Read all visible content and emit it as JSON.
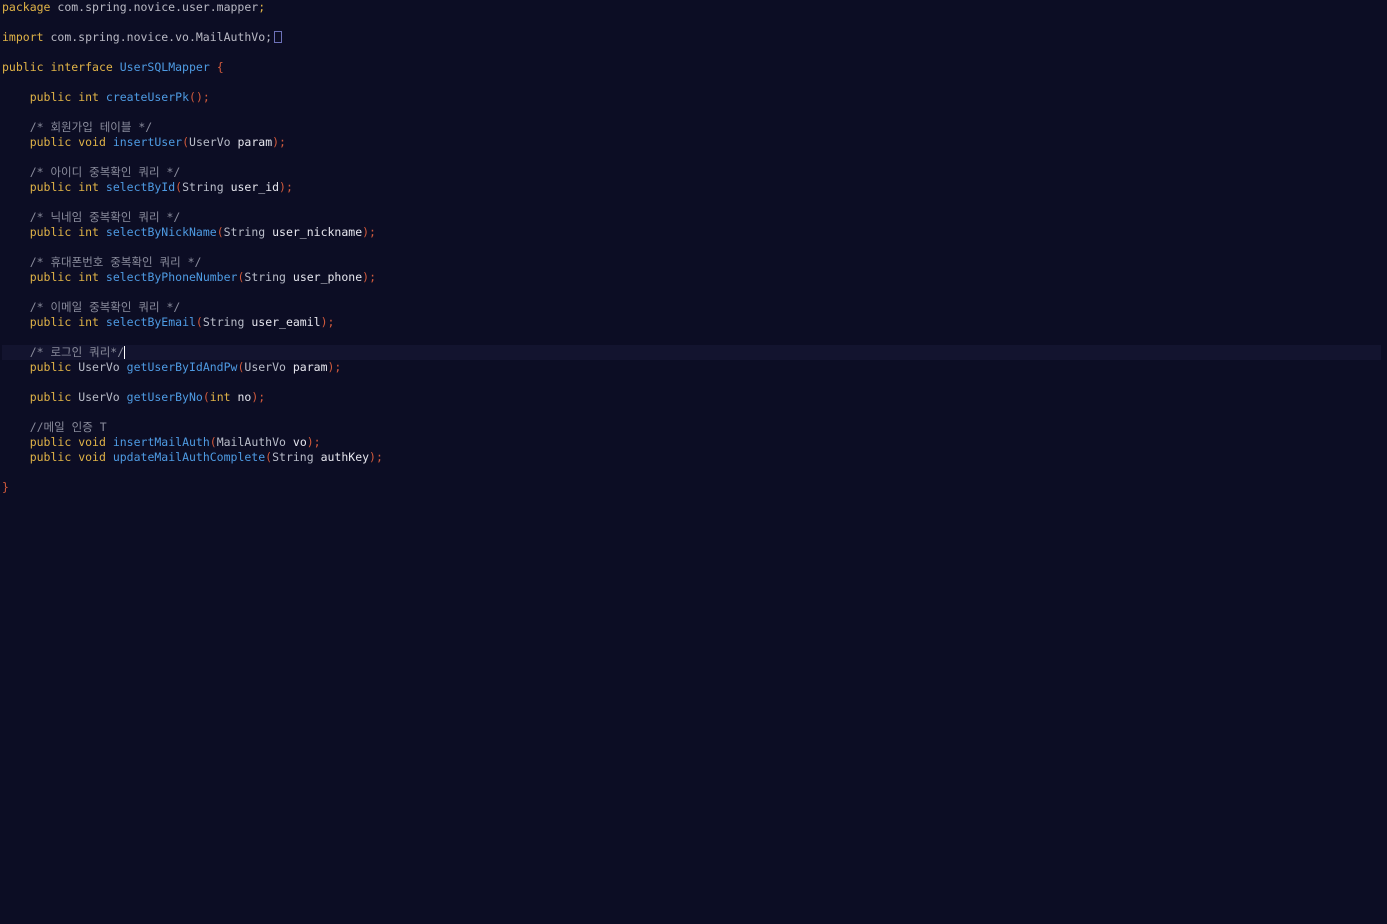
{
  "editor": {
    "package_line": {
      "keyword": "package",
      "name": "com.spring.novice.user.mapper",
      "semi": ";"
    },
    "import_line": {
      "keyword": "import",
      "name": "com.spring.novice.vo.MailAuthVo;"
    },
    "interface_decl": {
      "public": "public",
      "interface": "interface",
      "name": "UserSQLMapper",
      "open_brace": "{"
    },
    "methods": [
      {
        "comment": "",
        "public": "public",
        "ret": "int",
        "name": "createUserPk",
        "lparen": "(",
        "ptype": "",
        "pname": "",
        "rparen": ");"
      },
      {
        "comment": "/* 회원가입 테이블 */",
        "public": "public",
        "ret": "void",
        "name": "insertUser",
        "lparen": "(",
        "ptype": "UserVo",
        "pname": "param",
        "rparen": ");"
      },
      {
        "comment": "/* 아이디 중복확인 쿼리 */",
        "public": "public",
        "ret": "int",
        "name": "selectById",
        "lparen": "(",
        "ptype": "String",
        "pname": "user_id",
        "rparen": ");"
      },
      {
        "comment": "/* 닉네임 중복확인 쿼리 */",
        "public": "public",
        "ret": "int",
        "name": "selectByNickName",
        "lparen": "(",
        "ptype": "String",
        "pname": "user_nickname",
        "rparen": ");"
      },
      {
        "comment": "/* 휴대폰번호 중복확인 쿼리 */",
        "public": "public",
        "ret": "int",
        "name": "selectByPhoneNumber",
        "lparen": "(",
        "ptype": "String",
        "pname": "user_phone",
        "rparen": ");"
      },
      {
        "comment": "/* 이메일 중복확인 쿼리 */",
        "public": "public",
        "ret": "int",
        "name": "selectByEmail",
        "lparen": "(",
        "ptype": "String",
        "pname": "user_eamil",
        "rparen": ");"
      },
      {
        "comment": "/* 로그인 쿼리*/",
        "public": "public",
        "ret": "UserVo",
        "name": "getUserByIdAndPw",
        "lparen": "(",
        "ptype": "UserVo",
        "pname": "param",
        "rparen": ");"
      },
      {
        "comment": "",
        "public": "public",
        "ret": "UserVo",
        "name": "getUserByNo",
        "lparen": "(",
        "ptype": "int",
        "pname": "no",
        "rparen": ");"
      },
      {
        "comment": "//메일 인증 T",
        "public": "public",
        "ret": "void",
        "name": "insertMailAuth",
        "lparen": "(",
        "ptype": "MailAuthVo",
        "pname": "vo",
        "rparen": ");"
      },
      {
        "comment": "",
        "public": "public",
        "ret": "void",
        "name": "updateMailAuthComplete",
        "lparen": "(",
        "ptype": "String",
        "pname": "authKey",
        "rparen": ");"
      }
    ],
    "close_brace": "}"
  },
  "colors": {
    "background": "#0c0d24",
    "current_line": "#13142f",
    "keyword": "#e0b347",
    "method": "#4e9be3",
    "brace": "#d25a3c",
    "comment": "#8a8c9c"
  }
}
